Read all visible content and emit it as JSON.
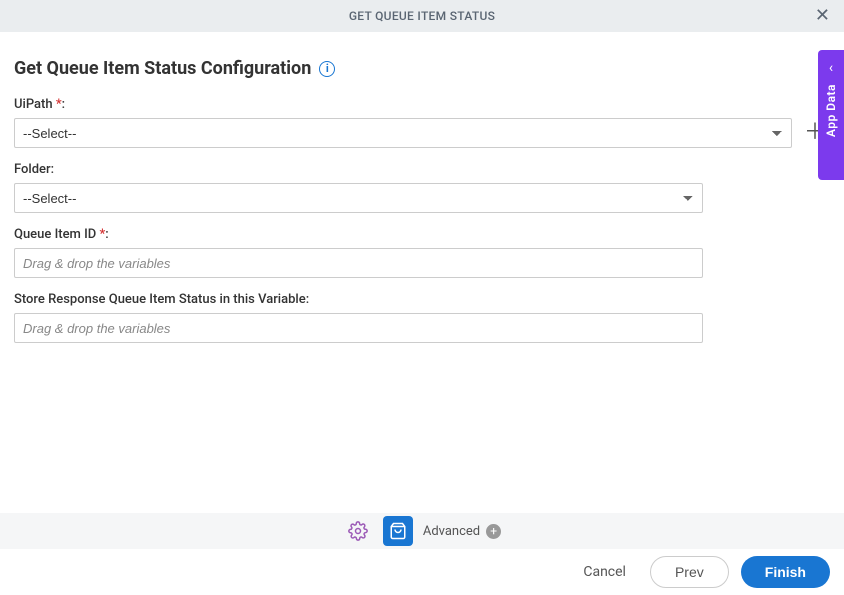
{
  "header": {
    "title": "GET QUEUE ITEM STATUS"
  },
  "page": {
    "title": "Get Queue Item Status Configuration"
  },
  "fields": {
    "uipath": {
      "label": "UiPath",
      "required_marker": " *",
      "colon": ":",
      "selected": "--Select--"
    },
    "folder": {
      "label": "Folder:",
      "selected": "--Select--"
    },
    "queue_item_id": {
      "label": "Queue Item ID",
      "required_marker": " *",
      "colon": ":",
      "placeholder": "Drag & drop the variables"
    },
    "store_response": {
      "label": "Store Response Queue Item Status in this Variable:",
      "placeholder": "Drag & drop the variables"
    }
  },
  "side_tab": {
    "label": "App Data"
  },
  "toolbar": {
    "advanced_label": "Advanced"
  },
  "footer": {
    "cancel": "Cancel",
    "prev": "Prev",
    "finish": "Finish"
  }
}
